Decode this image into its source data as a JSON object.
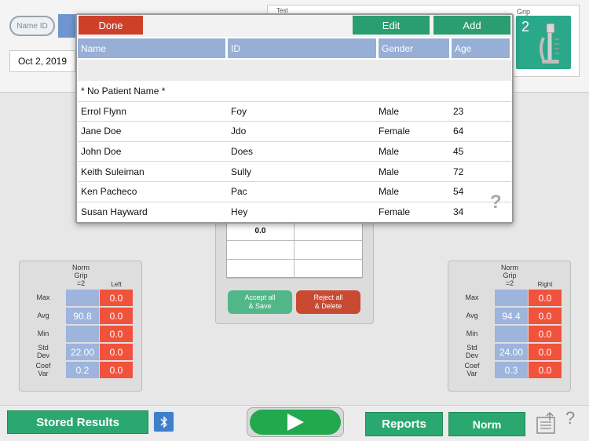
{
  "header": {
    "name_id_toggle": "Name ID",
    "date": "Oct 2, 2019",
    "test_label": "Test",
    "grip_label": "Grip",
    "grip_number": "2"
  },
  "popup": {
    "done_label": "Done",
    "edit_label": "Edit",
    "add_label": "Add",
    "columns": [
      "Name",
      "ID",
      "Gender",
      "Age"
    ],
    "patients": [
      {
        "name": "* No Patient Name *",
        "id": "",
        "gender": "",
        "age": ""
      },
      {
        "name": "Errol Flynn",
        "id": "Foy",
        "gender": "Male",
        "age": "23"
      },
      {
        "name": "Jane Doe",
        "id": "Jdo",
        "gender": "Female",
        "age": "64"
      },
      {
        "name": "John Doe",
        "id": "Does",
        "gender": "Male",
        "age": "45"
      },
      {
        "name": "Keith Suleiman",
        "id": "Sully",
        "gender": "Male",
        "age": "72"
      },
      {
        "name": "Ken Pacheco",
        "id": "Pac",
        "gender": "Male",
        "age": "54"
      },
      {
        "name": "Susan Hayward",
        "id": "Hey",
        "gender": "Female",
        "age": "34"
      }
    ],
    "help": "?"
  },
  "center": {
    "first_value": "0.0",
    "accept_label": "Accept all\n& Save",
    "reject_label": "Reject all\n& Delete"
  },
  "left_panel": {
    "norm_header": "Norm\nGrip\n=2",
    "side_header": "Left",
    "rows": [
      {
        "label": "Max",
        "norm": "",
        "value": "0.0"
      },
      {
        "label": "Avg",
        "norm": "90.8",
        "value": "0.0"
      },
      {
        "label": "Min",
        "norm": "",
        "value": "0.0"
      },
      {
        "label": "Std\nDev",
        "norm": "22.00",
        "value": "0.0"
      },
      {
        "label": "Coef\nVar",
        "norm": "0.2",
        "value": "0.0"
      }
    ]
  },
  "right_panel": {
    "norm_header": "Norm\nGrip\n=2",
    "side_header": "Right",
    "rows": [
      {
        "label": "Max",
        "norm": "",
        "value": "0.0"
      },
      {
        "label": "Avg",
        "norm": "94.4",
        "value": "0.0"
      },
      {
        "label": "Min",
        "norm": "",
        "value": "0.0"
      },
      {
        "label": "Std\nDev",
        "norm": "24.00",
        "value": "0.0"
      },
      {
        "label": "Coef\nVar",
        "norm": "0.3",
        "value": "0.0"
      }
    ]
  },
  "toolbar": {
    "stored_results_label": "Stored Results",
    "bluetooth_icon": "bluetooth-icon",
    "play_icon": "play-icon",
    "reports_label": "Reports",
    "norm_label": "Norm",
    "export_icon": "export-icon",
    "help": "?"
  }
}
